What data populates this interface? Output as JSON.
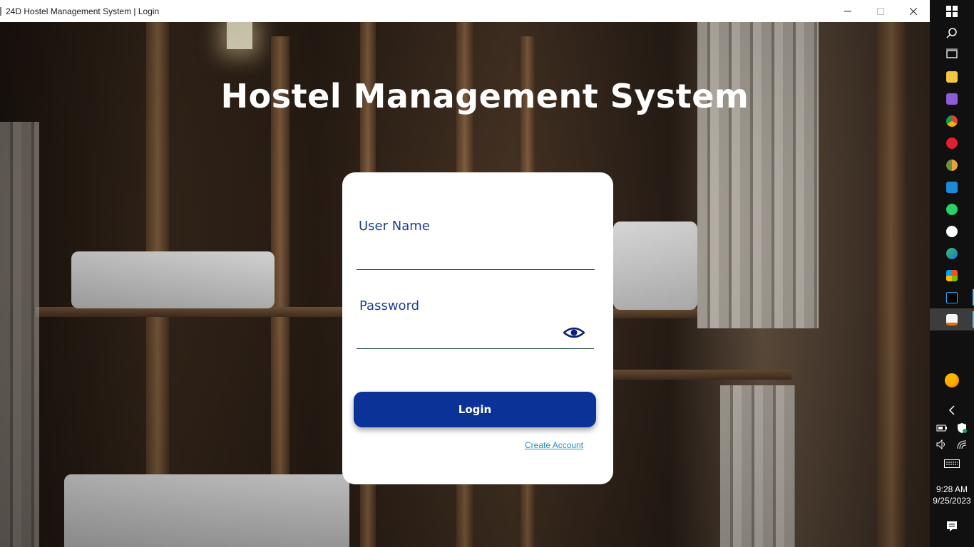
{
  "window": {
    "title": "24D Hostel Management System | Login",
    "controls": [
      "minimize-icon",
      "maximize-icon",
      "close-icon"
    ]
  },
  "page": {
    "heading": "Hostel Management System"
  },
  "login_form": {
    "username_label": "User Name",
    "username_value": "",
    "password_label": "Password",
    "password_value": "",
    "show_password_icon": "eye-icon",
    "login_button": "Login",
    "create_account_link": "Create Account"
  },
  "taskbar": {
    "apps": [
      "windows-start-icon",
      "search-icon",
      "task-view-icon",
      "file-explorer-icon",
      "visual-studio-icon",
      "chrome-icon",
      "opera-icon",
      "chrome-canary-icon",
      "mail-icon",
      "whatsapp-icon",
      "github-icon",
      "edge-icon",
      "microsoft-store-icon",
      "intellij-icon",
      "java-icon"
    ],
    "weather_icon": "weather-icon",
    "tray_icons": [
      "chevron-left-icon",
      "battery-icon",
      "shield-icon",
      "volume-icon",
      "wifi-icon",
      "keyboard-icon"
    ],
    "time": "9:28 AM",
    "date": "9/25/2023",
    "notification_icon": "notification-icon"
  },
  "colors": {
    "accent": "#0b3397",
    "label": "#1c3f94",
    "link": "#2a8fb3",
    "taskbar": "#101010"
  }
}
